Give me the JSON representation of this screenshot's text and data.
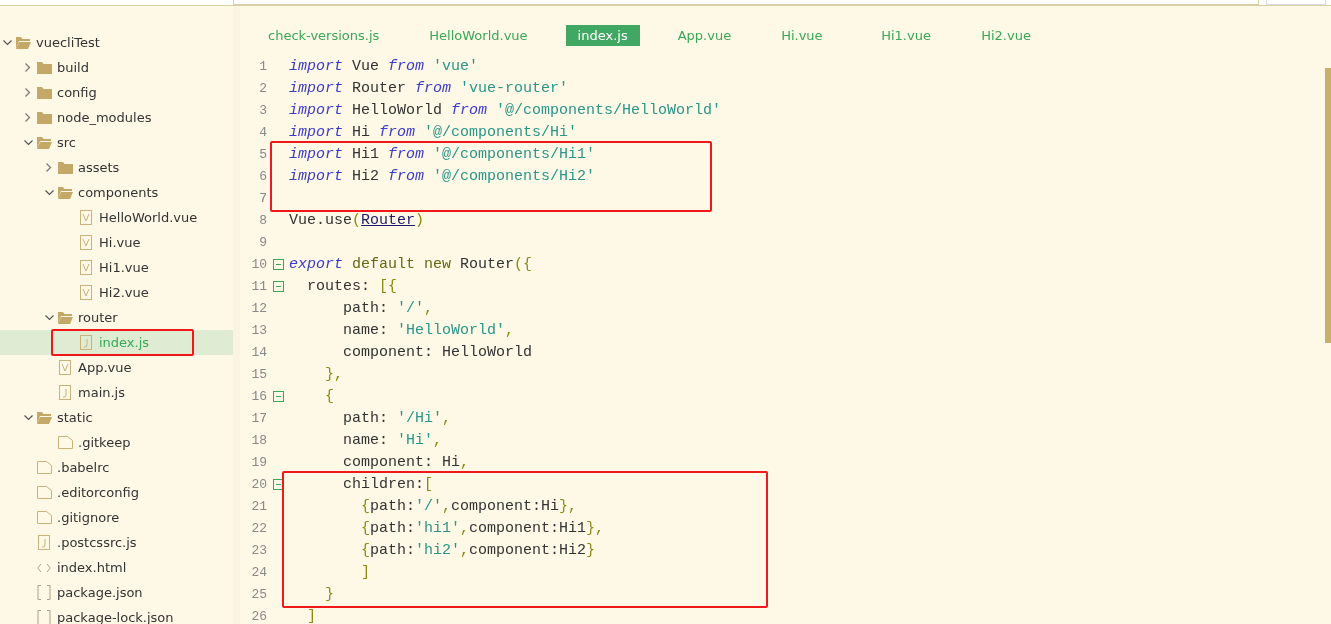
{
  "sidebar": {
    "tree": [
      {
        "label": "vuecliTest",
        "kind": "folder",
        "expanded": true,
        "children": [
          {
            "label": "build",
            "kind": "folder",
            "expanded": false
          },
          {
            "label": "config",
            "kind": "folder",
            "expanded": false
          },
          {
            "label": "node_modules",
            "kind": "folder",
            "expanded": false
          },
          {
            "label": "src",
            "kind": "folder",
            "expanded": true,
            "children": [
              {
                "label": "assets",
                "kind": "folder",
                "expanded": false
              },
              {
                "label": "components",
                "kind": "folder",
                "expanded": true,
                "children": [
                  {
                    "label": "HelloWorld.vue",
                    "kind": "vue",
                    "selected": false
                  },
                  {
                    "label": "Hi.vue",
                    "kind": "vue",
                    "selected": false
                  },
                  {
                    "label": "Hi1.vue",
                    "kind": "vue",
                    "selected": false
                  },
                  {
                    "label": "Hi2.vue",
                    "kind": "vue",
                    "selected": false
                  }
                ]
              },
              {
                "label": "router",
                "kind": "folder",
                "expanded": true,
                "children": [
                  {
                    "label": "index.js",
                    "kind": "js",
                    "selected": true,
                    "boxed": true
                  }
                ]
              },
              {
                "label": "App.vue",
                "kind": "vue",
                "selected": false
              },
              {
                "label": "main.js",
                "kind": "js",
                "selected": false
              }
            ]
          },
          {
            "label": "static",
            "kind": "folder",
            "expanded": true,
            "children": [
              {
                "label": ".gitkeep",
                "kind": "file",
                "selected": false
              }
            ]
          },
          {
            "label": ".babelrc",
            "kind": "file",
            "selected": false
          },
          {
            "label": ".editorconfig",
            "kind": "file",
            "selected": false
          },
          {
            "label": ".gitignore",
            "kind": "file",
            "selected": false
          },
          {
            "label": ".postcssrc.js",
            "kind": "js",
            "selected": false
          },
          {
            "label": "index.html",
            "kind": "html",
            "selected": false
          },
          {
            "label": "package.json",
            "kind": "json",
            "selected": false
          },
          {
            "label": "package-lock.json",
            "kind": "json",
            "selected": false
          }
        ]
      }
    ]
  },
  "tabs": [
    {
      "label": "check-versions.js",
      "selected": false
    },
    {
      "label": "HelloWorld.vue",
      "selected": false
    },
    {
      "label": "index.js",
      "selected": true
    },
    {
      "label": "App.vue",
      "selected": false
    },
    {
      "label": "Hi.vue",
      "selected": false
    },
    {
      "label": "Hi1.vue",
      "selected": false
    },
    {
      "label": "Hi2.vue",
      "selected": false
    }
  ],
  "editor": {
    "lines": [
      {
        "number": "1",
        "tokens": [
          {
            "kind": "kw",
            "text": "import"
          },
          {
            "kind": "plain",
            "text": " Vue "
          },
          {
            "kind": "kw",
            "text": "from"
          },
          {
            "kind": "str",
            "text": " 'vue'"
          }
        ]
      },
      {
        "number": "2",
        "tokens": [
          {
            "kind": "kw",
            "text": "import"
          },
          {
            "kind": "plain",
            "text": " Router "
          },
          {
            "kind": "kw",
            "text": "from"
          },
          {
            "kind": "str",
            "text": " 'vue-router'"
          }
        ]
      },
      {
        "number": "3",
        "tokens": [
          {
            "kind": "kw",
            "text": "import"
          },
          {
            "kind": "plain",
            "text": " HelloWorld "
          },
          {
            "kind": "kw",
            "text": "from"
          },
          {
            "kind": "str",
            "text": " '@/components/HelloWorld'"
          }
        ]
      },
      {
        "number": "4",
        "tokens": [
          {
            "kind": "kw",
            "text": "import"
          },
          {
            "kind": "plain",
            "text": " Hi "
          },
          {
            "kind": "kw",
            "text": "from"
          },
          {
            "kind": "str",
            "text": " '@/components/Hi'"
          }
        ]
      },
      {
        "number": "5",
        "boxed": true,
        "tokens": [
          {
            "kind": "kw",
            "text": "import"
          },
          {
            "kind": "plain",
            "text": " Hi1 "
          },
          {
            "kind": "kw",
            "text": "from"
          },
          {
            "kind": "str",
            "text": " '@/components/Hi1'"
          }
        ]
      },
      {
        "number": "6",
        "boxed": true,
        "tokens": [
          {
            "kind": "kw",
            "text": "import"
          },
          {
            "kind": "plain",
            "text": " Hi2 "
          },
          {
            "kind": "kw",
            "text": "from"
          },
          {
            "kind": "str",
            "text": " '@/components/Hi2'"
          }
        ]
      },
      {
        "number": "7",
        "boxed": true
      },
      {
        "number": "8",
        "tokens": [
          {
            "kind": "plain",
            "text": "Vue.use"
          },
          {
            "kind": "punct",
            "text": "("
          },
          {
            "kind": "link",
            "text": "Router"
          },
          {
            "kind": "punct",
            "text": ")"
          }
        ]
      },
      {
        "number": "9"
      },
      {
        "number": "10",
        "expanded": true,
        "tokens": [
          {
            "kind": "kw",
            "text": "export"
          },
          {
            "kind": "kw2",
            "text": " default new "
          },
          {
            "kind": "plain",
            "text": "Router"
          },
          {
            "kind": "punct",
            "text": "({"
          }
        ]
      },
      {
        "number": "11",
        "expanded": true,
        "tokens": [
          {
            "kind": "plain",
            "text": "  routes: "
          },
          {
            "kind": "punct",
            "text": "[{"
          }
        ]
      },
      {
        "number": "12",
        "tokens": [
          {
            "kind": "plain",
            "text": "      path: "
          },
          {
            "kind": "str",
            "text": "'/'"
          },
          {
            "kind": "punct",
            "text": ","
          }
        ]
      },
      {
        "number": "13",
        "tokens": [
          {
            "kind": "plain",
            "text": "      name: "
          },
          {
            "kind": "str",
            "text": "'HelloWorld'"
          },
          {
            "kind": "punct",
            "text": ","
          }
        ]
      },
      {
        "number": "14",
        "tokens": [
          {
            "kind": "plain",
            "text": "      component: HelloWorld"
          }
        ]
      },
      {
        "number": "15",
        "tokens": [
          {
            "kind": "punct",
            "text": "    },"
          }
        ]
      },
      {
        "number": "16",
        "expanded": true,
        "tokens": [
          {
            "kind": "punct",
            "text": "    {"
          }
        ]
      },
      {
        "number": "17",
        "tokens": [
          {
            "kind": "plain",
            "text": "      path: "
          },
          {
            "kind": "str",
            "text": "'/Hi'"
          },
          {
            "kind": "punct",
            "text": ","
          }
        ]
      },
      {
        "number": "18",
        "tokens": [
          {
            "kind": "plain",
            "text": "      name: "
          },
          {
            "kind": "str",
            "text": "'Hi'"
          },
          {
            "kind": "punct",
            "text": ","
          }
        ]
      },
      {
        "number": "19",
        "tokens": [
          {
            "kind": "plain",
            "text": "      component: Hi"
          },
          {
            "kind": "punct",
            "text": ","
          }
        ]
      },
      {
        "number": "20",
        "expanded": true,
        "boxed": true,
        "tokens": [
          {
            "kind": "plain",
            "text": "      children:"
          },
          {
            "kind": "punct",
            "text": "["
          }
        ]
      },
      {
        "number": "21",
        "boxed": true,
        "tokens": [
          {
            "kind": "punct",
            "text": "        {"
          },
          {
            "kind": "plain",
            "text": "path:"
          },
          {
            "kind": "str",
            "text": "'/'"
          },
          {
            "kind": "punct",
            "text": ","
          },
          {
            "kind": "plain",
            "text": "component:Hi"
          },
          {
            "kind": "punct",
            "text": "},"
          }
        ]
      },
      {
        "number": "22",
        "boxed": true,
        "tokens": [
          {
            "kind": "punct",
            "text": "        {"
          },
          {
            "kind": "plain",
            "text": "path:"
          },
          {
            "kind": "str",
            "text": "'hi1'"
          },
          {
            "kind": "punct",
            "text": ","
          },
          {
            "kind": "plain",
            "text": "component:Hi1"
          },
          {
            "kind": "punct",
            "text": "},"
          }
        ]
      },
      {
        "number": "23",
        "boxed": true,
        "tokens": [
          {
            "kind": "punct",
            "text": "        {"
          },
          {
            "kind": "plain",
            "text": "path:"
          },
          {
            "kind": "str",
            "text": "'hi2'"
          },
          {
            "kind": "punct",
            "text": ","
          },
          {
            "kind": "plain",
            "text": "component:Hi2"
          },
          {
            "kind": "punct",
            "text": "}"
          }
        ]
      },
      {
        "number": "24",
        "boxed": true,
        "tokens": [
          {
            "kind": "punct",
            "text": "        ]"
          }
        ]
      },
      {
        "number": "25",
        "boxed": true,
        "tokens": [
          {
            "kind": "punct",
            "text": "    }"
          }
        ]
      },
      {
        "number": "26",
        "tokens": [
          {
            "kind": "punct",
            "text": "  ]"
          }
        ]
      }
    ]
  }
}
